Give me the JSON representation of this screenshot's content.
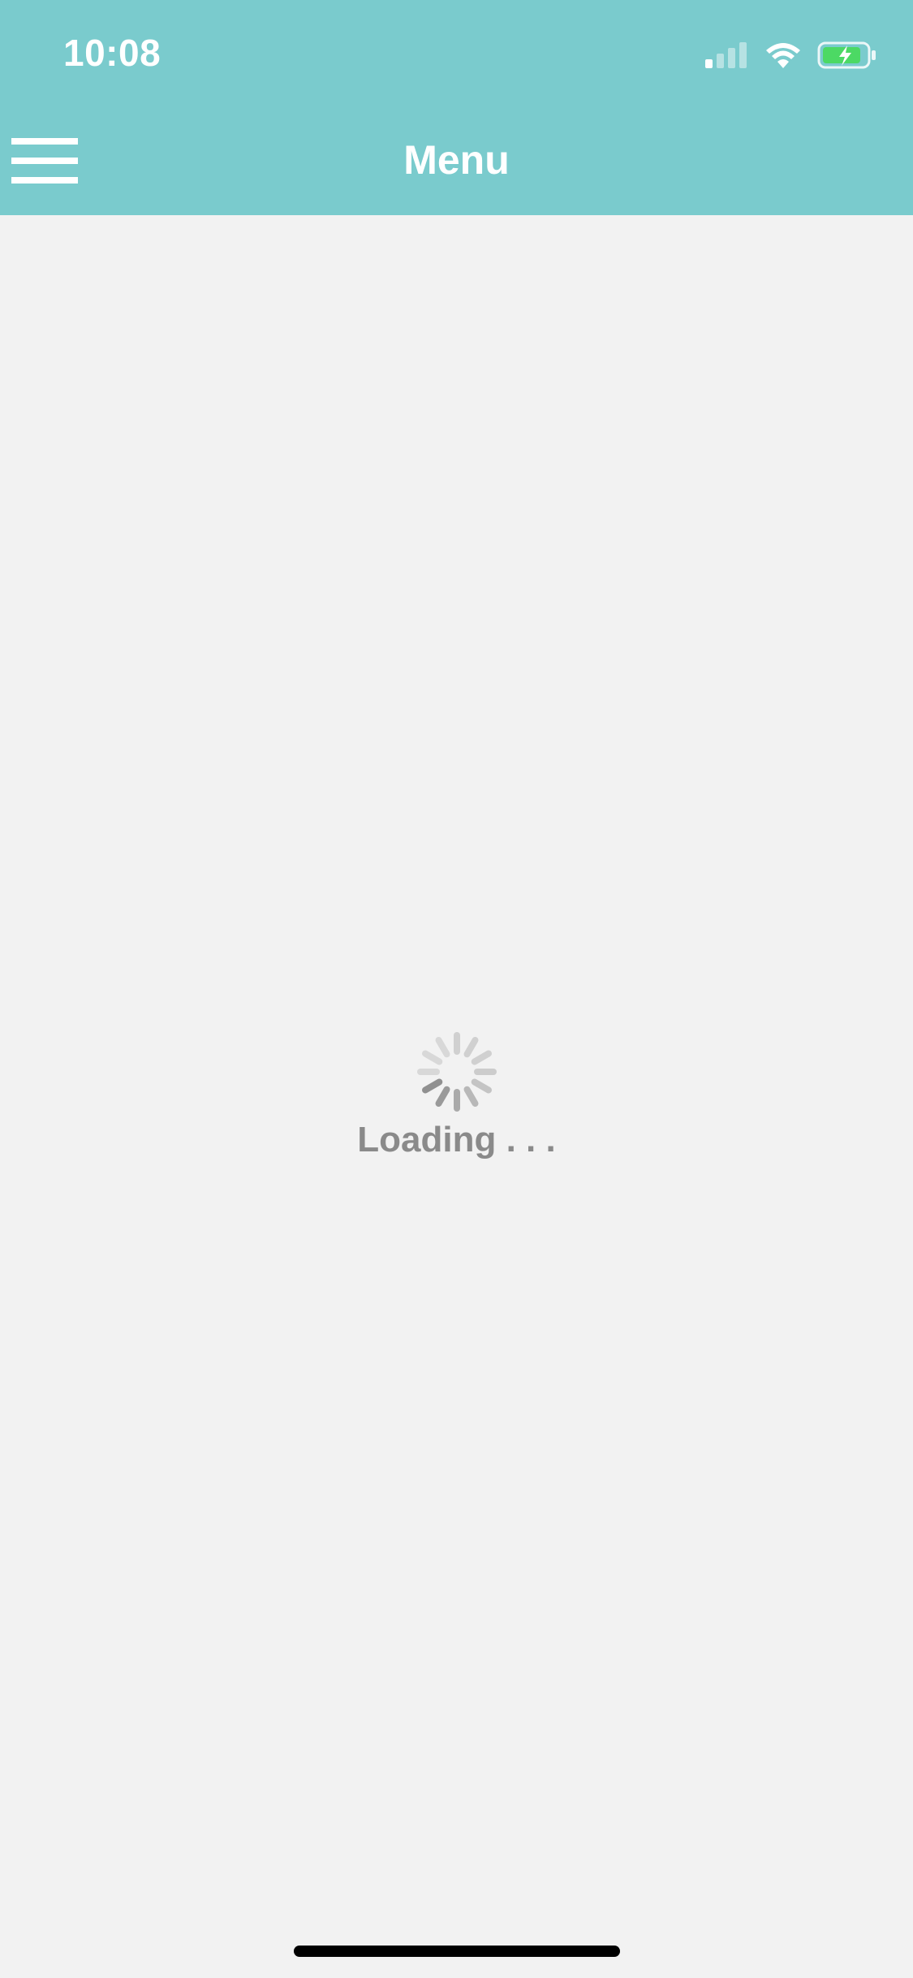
{
  "status_bar": {
    "time": "10:08",
    "icons": [
      "cellular-signal-icon",
      "wifi-icon",
      "battery-charging-icon"
    ]
  },
  "header": {
    "title": "Menu",
    "menu_icon": "hamburger-menu-icon",
    "background_color": "#7acbcd"
  },
  "content": {
    "loading_text": "Loading . . .",
    "spinner_icon": "activity-spinner-icon",
    "background_color": "#f2f2f2"
  }
}
